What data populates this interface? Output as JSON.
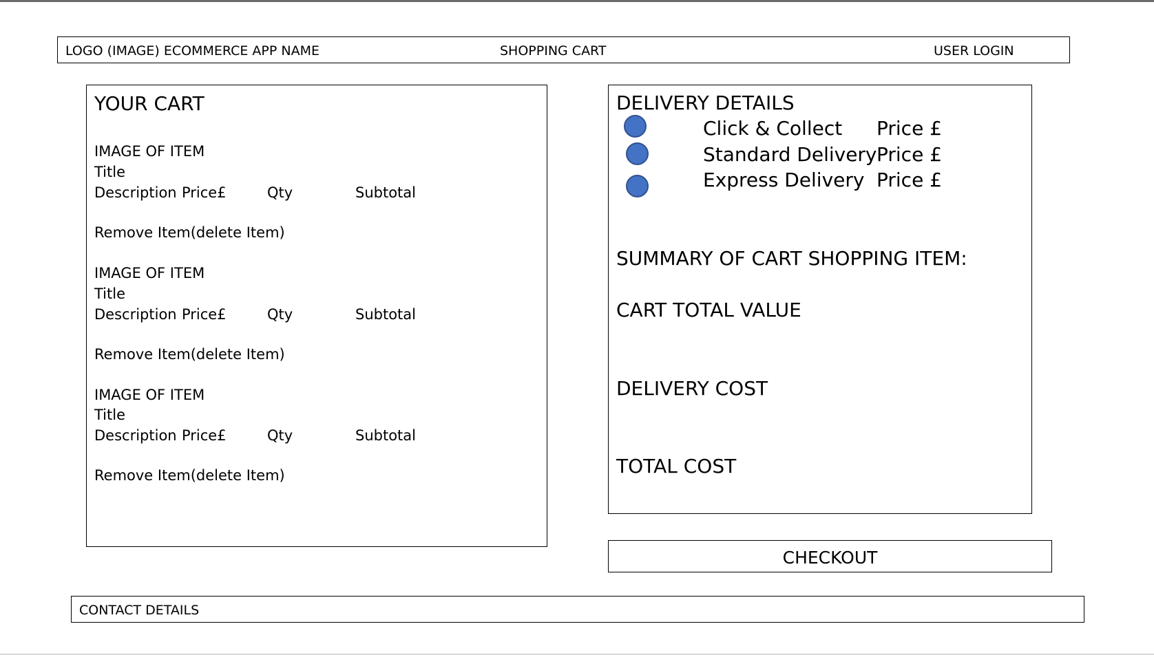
{
  "header": {
    "logo_text": "LOGO (IMAGE) ECOMMERCE APP NAME",
    "title": "SHOPPING CART",
    "login": "USER LOGIN"
  },
  "cart": {
    "title": "YOUR CART",
    "items": [
      {
        "image": "IMAGE OF ITEM",
        "title": "Title",
        "description": "Description",
        "price": "Price£",
        "qty": "Qty",
        "subtotal": "Subtotal",
        "remove": "Remove Item(delete Item)"
      },
      {
        "image": "IMAGE OF ITEM",
        "title": "Title",
        "description": "Description",
        "price": "Price£",
        "qty": "Qty",
        "subtotal": "Subtotal",
        "remove": "Remove Item(delete Item)"
      },
      {
        "image": "IMAGE OF ITEM",
        "title": "Title",
        "description": "Description",
        "price": "Price£",
        "qty": "Qty",
        "subtotal": "Subtotal",
        "remove": "Remove Item(delete Item)"
      }
    ]
  },
  "delivery": {
    "title": "DELIVERY DETAILS",
    "radio_color": "#4472c4",
    "options": [
      {
        "label": "Click & Collect",
        "price": "Price £"
      },
      {
        "label": "Standard Delivery",
        "price": "Price £"
      },
      {
        "label": "Express Delivery",
        "price": "Price £"
      }
    ]
  },
  "summary": {
    "heading": "SUMMARY OF CART SHOPPING ITEM:",
    "cart_total": "CART TOTAL VALUE",
    "delivery_cost": "DELIVERY COST",
    "total_cost": "TOTAL COST"
  },
  "checkout": {
    "label": "CHECKOUT"
  },
  "footer": {
    "contact": "CONTACT DETAILS"
  }
}
